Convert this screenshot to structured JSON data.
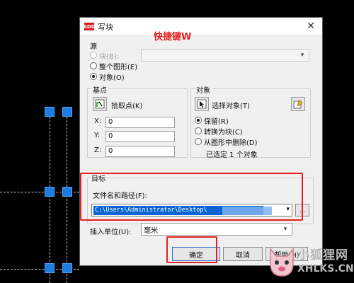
{
  "window": {
    "title": "写块",
    "app_icon_text": "ADD",
    "annotation": "快捷键W"
  },
  "source": {
    "heading": "源",
    "options": [
      {
        "label": "块(B):",
        "checked": false,
        "disabled": true
      },
      {
        "label": "整个图形(E)",
        "checked": false,
        "disabled": false
      },
      {
        "label": "对象(O)",
        "checked": true,
        "disabled": false
      }
    ],
    "block_select_value": ""
  },
  "base_point": {
    "heading": "基点",
    "pick_label": "拾取点(K)",
    "coords": [
      {
        "label": "X:",
        "value": "0"
      },
      {
        "label": "Y:",
        "value": "0"
      },
      {
        "label": "Z:",
        "value": "0"
      }
    ]
  },
  "objects": {
    "heading": "对象",
    "select_label": "选择对象(T)",
    "options": [
      {
        "label": "保留(R)",
        "checked": true
      },
      {
        "label": "转换为块(C)",
        "checked": false
      },
      {
        "label": "从图形中删除(D)",
        "checked": false
      }
    ],
    "selected_count_text": "已选定 1 个对象"
  },
  "target": {
    "heading": "目标",
    "path_label": "文件名和路径(F):",
    "path_value": "C:\\Users\\Administrator\\Desktop\\",
    "browse_label": "...",
    "units_label": "插入单位(U):",
    "units_value": "毫米"
  },
  "buttons": {
    "ok": "确定",
    "cancel": "取消",
    "help": "帮助(H)"
  },
  "watermark": {
    "line1": "小狐狸网",
    "line2": "XHLKS.CN"
  },
  "colors": {
    "highlight_red": "#e32020",
    "selection_blue": "#0a64d6",
    "grip_blue": "#1e7be0"
  }
}
